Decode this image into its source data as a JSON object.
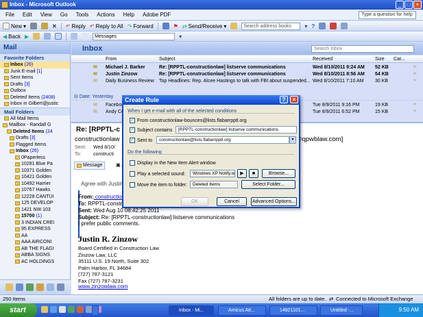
{
  "window": {
    "title": "Inbox - Microsoft Outlook"
  },
  "menu": [
    "File",
    "Edit",
    "View",
    "Go",
    "Tools",
    "Actions",
    "Help",
    "Adobe PDF"
  ],
  "help_box": "Type a question for help",
  "toolbar1": {
    "new": "New",
    "reply": "Reply",
    "reply_all": "Reply to All",
    "forward": "Forward",
    "send_receive": "Send/Receive",
    "search_book": "Search address books"
  },
  "toolbar2": {
    "back": "Back",
    "messages": "Messages"
  },
  "nav": {
    "title": "Mail",
    "favorites_header": "Favorite Folders",
    "favorites": [
      {
        "name": "Inbox",
        "count": "(26)"
      },
      {
        "name": "Junk E-mail",
        "count": "[1]"
      },
      {
        "name": "Sent Items",
        "count": ""
      },
      {
        "name": "Drafts",
        "count": "[3]"
      },
      {
        "name": "Outbox",
        "count": ""
      },
      {
        "name": "Deleted Items",
        "count": "(2408)"
      },
      {
        "name": "Inbox in Gilbert@justic",
        "count": ""
      }
    ],
    "mail_folders_header": "Mail Folders",
    "all_items": "All Mail Items",
    "tree": [
      {
        "name": "Mailbox - Randall G",
        "count": ""
      },
      {
        "name": "Deleted Items",
        "count": "(24"
      },
      {
        "name": "Drafts",
        "count": "[3]"
      },
      {
        "name": "Flagged Items",
        "count": ""
      },
      {
        "name": "Inbox",
        "count": "(26)"
      },
      {
        "name": "0Paperless",
        "count": ""
      },
      {
        "name": "10281 Blue Pa",
        "count": ""
      },
      {
        "name": "10371 Golden",
        "count": ""
      },
      {
        "name": "10421 Golden",
        "count": ""
      },
      {
        "name": "10492 Harrier",
        "count": ""
      },
      {
        "name": "10767 Hawks",
        "count": ""
      },
      {
        "name": "12228 CANTUI",
        "count": ""
      },
      {
        "name": "125 DEVELOP",
        "count": ""
      },
      {
        "name": "1421 NW 103",
        "count": ""
      },
      {
        "name": "15700",
        "count": "(1)"
      },
      {
        "name": "3 INDIAN CREI",
        "count": ""
      },
      {
        "name": "95 EXPRESS",
        "count": ""
      },
      {
        "name": "AA",
        "count": ""
      },
      {
        "name": "AAA AIRCONI",
        "count": ""
      },
      {
        "name": "AB THE FLAGI",
        "count": ""
      },
      {
        "name": "ABBA SIGNS",
        "count": ""
      },
      {
        "name": "AC HOLDINGS",
        "count": ""
      }
    ]
  },
  "list": {
    "title": "Inbox",
    "search_placeholder": "Search Inbox",
    "columns": {
      "from": "From",
      "subject": "Subject",
      "received": "Received",
      "size": "Size",
      "cat": "Cat..."
    },
    "messages": [
      {
        "from": "Michael J. Barker",
        "subject": "Re: [RPPTL-constructionlaw] listserve communications",
        "received": "Wed 8/10/2011 9:24 AM",
        "size": "52 KB"
      },
      {
        "from": "Justin Zinzow",
        "subject": "Re: [RPPTL-constructionlaw] listserve communications",
        "received": "Wed 8/10/2011 8:56 AM",
        "size": "54 KB"
      },
      {
        "from": "Daily Business Review",
        "subject": "Top Headlines: Rep. Alcee Hastings to talk with FBI about suspended...",
        "received": "Wed 8/10/2011 7:10 AM",
        "size": "30 KB"
      }
    ],
    "group": "Date: Yesterday",
    "messages2": [
      {
        "from": "Faceboo",
        "received": "Tue 8/9/2011 9:16 PM",
        "size": "19 KB"
      },
      {
        "from": "Andy Co",
        "received": "Tue 8/9/2011 6:52 PM",
        "size": "15 KB"
      }
    ]
  },
  "reading": {
    "subject": "Re: [RPPTL-c",
    "from_line": "constructionlaw",
    "sent_label": "Sent:",
    "sent_val": "Wed 8/10/",
    "to_label": "To:",
    "to_val": "constructi",
    "right_addr": "barker@qpwblaw.com]",
    "message_tab": "Message",
    "att": "AT",
    "agree": "Agree with Justin",
    "hdr": [
      {
        "k": "From:",
        "v": " construction"
      },
      {
        "k": "To:",
        "v": " RPPTL-constructi"
      },
      {
        "k": "Sent:",
        "v": " Wed Aug 10 08:42:25 2011"
      },
      {
        "k": "Subject:",
        "v": " Re: [RPPTL-constructionlaw] listserve communications"
      }
    ],
    "pref": "I prefer public comments.",
    "sig_name": "Justin R. Zinzow",
    "sig": [
      "Board Certified in Construction Law",
      "Zinzow Law, LLC",
      "35111 U.S. 19 North, Suite 302",
      "Palm Harbor, FL 34684",
      "(727) 787-3121",
      "Fax (727) 787-3231"
    ],
    "sig_link": "www.zinzowlaw.com"
  },
  "dialog": {
    "title": "Create Rule",
    "cond_header": "When I get e-mail with all of the selected conditions",
    "from": "From constructionlaw-bounces@lists.flabarrpptl.org",
    "subject_label": "Subject contains",
    "subject_val": "[RPPTL-constructionlaw] listserve communications",
    "sentto_label": "Sent to",
    "sentto_val": "constructionlaw@lists.flabarrpptl.org",
    "do_header": "Do the following",
    "display": "Display in the New Item Alert window",
    "sound": "Play a selected sound:",
    "sound_val": "Windows XP Notify.w",
    "browse": "Browse...",
    "move": "Move the item to folder:",
    "move_val": "Deleted Items",
    "select_folder": "Select Folder...",
    "ok": "OK",
    "cancel": "Cancel",
    "advanced": "Advanced Options..."
  },
  "status": {
    "left": "250 Items",
    "mid": "All folders are up to date.",
    "right": "Connected to Microsoft Exchange"
  },
  "taskbar": {
    "start": "start",
    "items": [
      "Inbox - Mi...",
      "Amicus Att...",
      "14821101...",
      "Untitled -..."
    ],
    "clock": "9:50 AM"
  }
}
